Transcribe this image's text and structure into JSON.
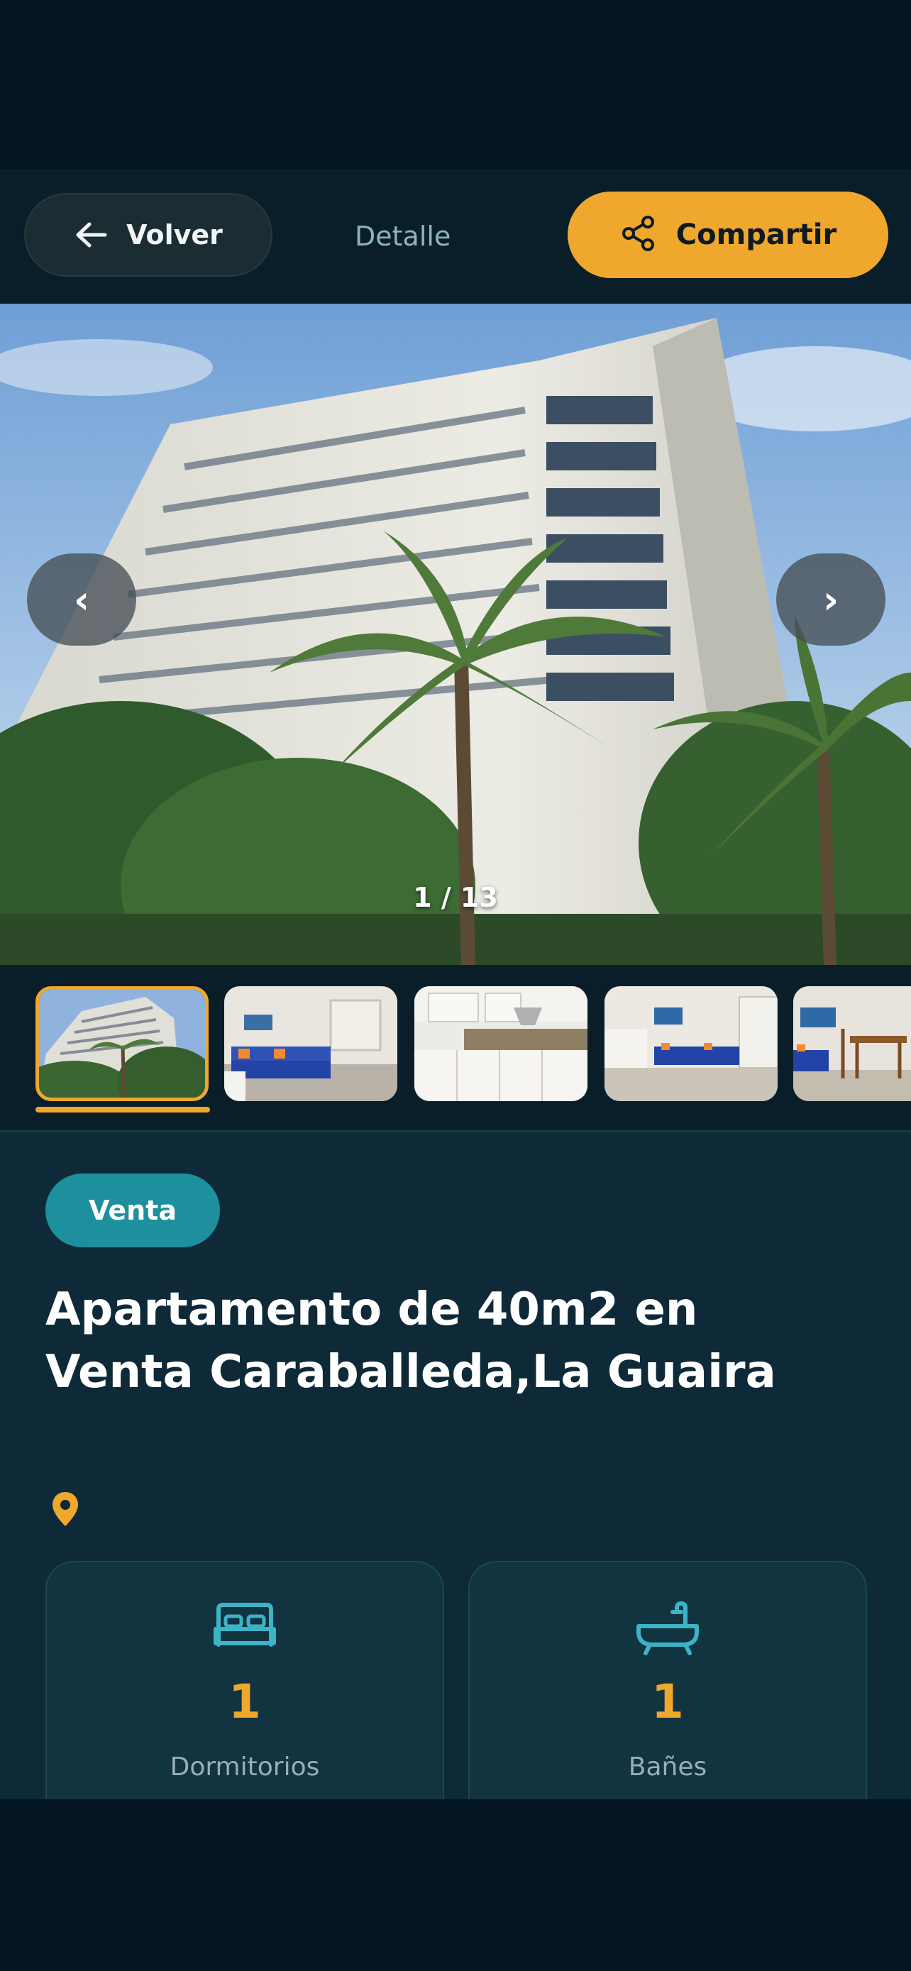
{
  "header": {
    "back_label": "Volver",
    "title": "Detalle",
    "share_label": "Compartir",
    "accent_color": "#efa72d"
  },
  "gallery": {
    "counter": "1 / 13",
    "prev_glyph": "‹",
    "next_glyph": "›",
    "thumbnails": [
      "building-exterior",
      "living-room",
      "kitchen",
      "living-room",
      "dining-room"
    ],
    "selected_thumbnail": 1
  },
  "listing": {
    "badge": "Venta",
    "badge_color": "#1e8f9d",
    "title": "Apartamento de 40m2 en Venta Caraballeda,La Guaira",
    "location_icon": "location-pin-icon",
    "stats": [
      {
        "icon": "bed-icon",
        "value": "1",
        "label": "Dormitorios"
      },
      {
        "icon": "bathtub-icon",
        "value": "1",
        "label": "Bañes"
      }
    ]
  }
}
